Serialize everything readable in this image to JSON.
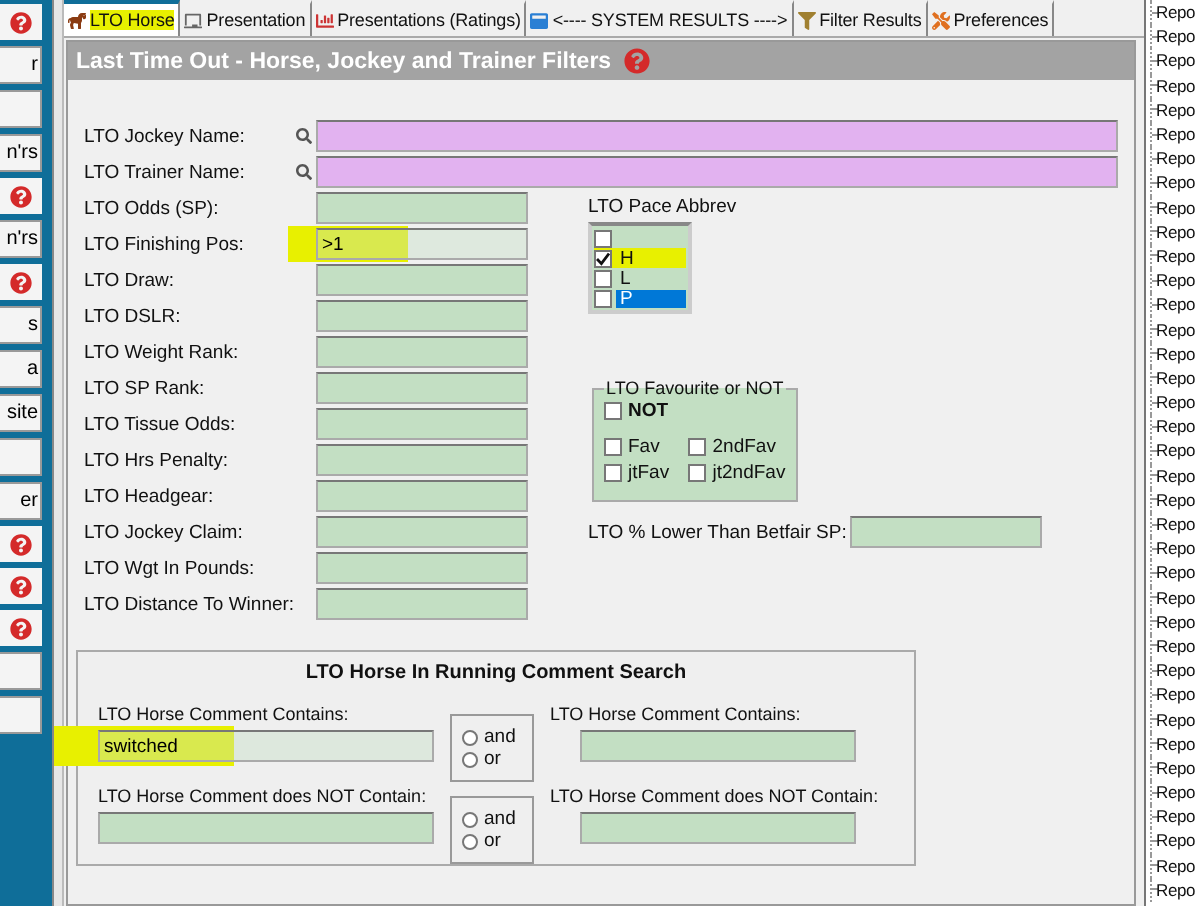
{
  "side_strip": [
    {
      "kind": "help"
    },
    {
      "kind": "button",
      "label": "r"
    },
    {
      "kind": "button"
    },
    {
      "kind": "button",
      "label": "n'rs"
    },
    {
      "kind": "help"
    },
    {
      "kind": "button",
      "label": "n'rs"
    },
    {
      "kind": "help"
    },
    {
      "kind": "button",
      "label": "s"
    },
    {
      "kind": "button",
      "label": "a"
    },
    {
      "kind": "button",
      "label": "site"
    },
    {
      "kind": "button"
    },
    {
      "kind": "button",
      "label": "er"
    },
    {
      "kind": "help"
    },
    {
      "kind": "help"
    },
    {
      "kind": "help"
    },
    {
      "kind": "button"
    },
    {
      "kind": "button"
    }
  ],
  "tabs": [
    {
      "label": "LTO Horse",
      "selected": true,
      "highlighted": true
    },
    {
      "label": "Presentation",
      "selected": false,
      "highlighted": false
    },
    {
      "label": "Presentations (Ratings)",
      "selected": false,
      "highlighted": false
    },
    {
      "label": "<---- SYSTEM RESULTS ---->",
      "selected": false,
      "highlighted": false
    },
    {
      "label": "Filter Results",
      "selected": false,
      "highlighted": false
    },
    {
      "label": "Preferences",
      "selected": false,
      "highlighted": false
    }
  ],
  "panel": {
    "title": "Last Time Out - Horse, Jockey and Trainer Filters"
  },
  "fields": [
    {
      "kind": "search",
      "label": "LTO Jockey Name:"
    },
    {
      "kind": "search",
      "label": "LTO Trainer Name:"
    },
    {
      "kind": "text",
      "label": "LTO Odds (SP):"
    },
    {
      "kind": "text",
      "label": "LTO Finishing Pos:",
      "value": ">1",
      "highlighted": true
    },
    {
      "kind": "text",
      "label": "LTO Draw:"
    },
    {
      "kind": "text",
      "label": "LTO DSLR:"
    },
    {
      "kind": "text",
      "label": "LTO Weight Rank:"
    },
    {
      "kind": "text",
      "label": "LTO SP Rank:"
    },
    {
      "kind": "text",
      "label": "LTO Tissue Odds:"
    },
    {
      "kind": "text",
      "label": "LTO Hrs Penalty:"
    },
    {
      "kind": "text",
      "label": "LTO Headgear:"
    },
    {
      "kind": "text",
      "label": "LTO Jockey Claim:"
    },
    {
      "kind": "text",
      "label": "LTO Wgt In Pounds:"
    },
    {
      "kind": "text",
      "label": "LTO Distance To Winner:"
    }
  ],
  "pace_abbrev": {
    "label": "LTO Pace Abbrev",
    "items": [
      {
        "checked": false,
        "selected": false,
        "highlighted": false
      },
      {
        "label": "H",
        "checked": true,
        "selected": false,
        "highlighted": true
      },
      {
        "label": "L",
        "checked": false,
        "selected": false,
        "highlighted": false
      },
      {
        "label": "P",
        "checked": false,
        "selected": true,
        "highlighted": false
      }
    ]
  },
  "favourite": {
    "label": "LTO Favourite or NOT",
    "not": {
      "label": "NOT",
      "checked": false
    },
    "options": [
      {
        "label": "Fav",
        "checked": false
      },
      {
        "label": "2ndFav",
        "checked": false
      },
      {
        "label": "jtFav",
        "checked": false
      },
      {
        "label": "jt2ndFav",
        "checked": false
      }
    ]
  },
  "betfair": {
    "label": "LTO % Lower Than Betfair SP:"
  },
  "comment_search": {
    "title": "LTO Horse In Running Comment Search",
    "rows": [
      {
        "left_label": "LTO Horse Comment Contains:",
        "left_value": "switched",
        "left_highlighted": true,
        "options": [
          {
            "label": "and",
            "selected": false
          },
          {
            "label": "or",
            "selected": false
          }
        ],
        "right_label": "LTO Horse Comment Contains:"
      },
      {
        "left_label": "LTO Horse Comment does NOT Contain:",
        "options": [
          {
            "label": "and",
            "selected": false
          },
          {
            "label": "or",
            "selected": false
          }
        ],
        "right_label": "LTO Horse Comment does NOT Contain:"
      }
    ]
  },
  "tree": [
    "Repo",
    "Repo",
    "Repo",
    "Repo",
    "Repo",
    "Repo",
    "Repo",
    "Repo",
    "Repo",
    "Repo",
    "Repo",
    "Repo",
    "Repo",
    "Repo",
    "Repo",
    "Repo",
    "Repo",
    "Repo",
    "Repo",
    "Repo",
    "Repo",
    "Repo",
    "Repo",
    "Repo",
    "Repo",
    "Repo",
    "Repo",
    "Repo",
    "Repo",
    "Repo",
    "Repo",
    "Repo",
    "Repo",
    "Repo",
    "Repo",
    "Repo",
    "Repo"
  ]
}
